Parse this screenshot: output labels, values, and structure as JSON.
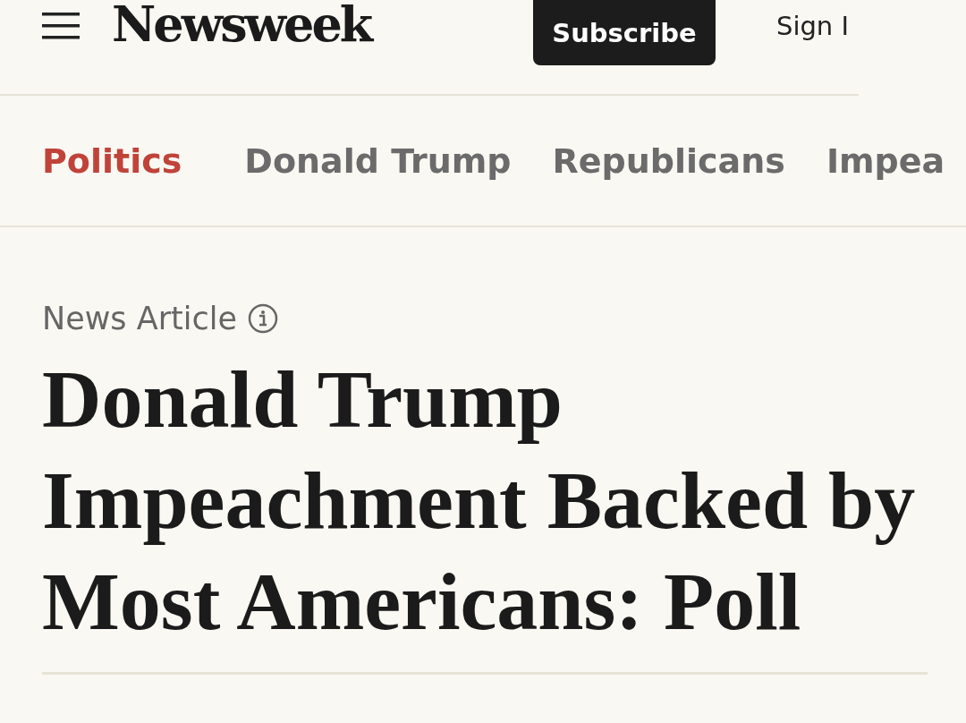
{
  "header": {
    "logo": "Newsweek",
    "subscribe": "Subscribe",
    "sign_in": "Sign I"
  },
  "nav": [
    {
      "label": "Politics",
      "selected": true
    },
    {
      "label": "Donald Trump",
      "selected": false
    },
    {
      "label": "Republicans",
      "selected": false
    },
    {
      "label": "Impea",
      "selected": false
    }
  ],
  "article": {
    "type_label": "News Article",
    "headline": "Donald Trump Impeachment Backed by Most Americans: Poll"
  }
}
